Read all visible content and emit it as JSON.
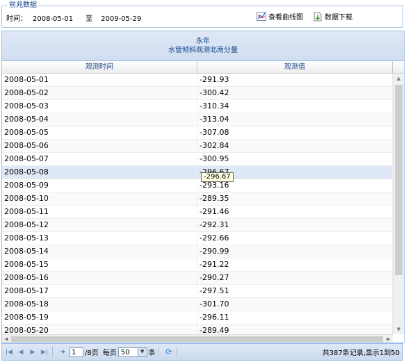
{
  "filter": {
    "legend": "前兆数据",
    "time_label": "时间：",
    "start_date": "2008-05-01",
    "to_label": "至",
    "end_date": "2009-05-29",
    "view_chart_label": "查看曲线图",
    "download_label": "数据下载"
  },
  "grid": {
    "title_line1": "永年",
    "title_line2": "水管倾斜观测北南分量",
    "col_time": "观测时间",
    "col_value": "观测值",
    "rows": [
      {
        "time": "2008-05-01",
        "value": "-291.93"
      },
      {
        "time": "2008-05-02",
        "value": "-300.42"
      },
      {
        "time": "2008-05-03",
        "value": "-310.34"
      },
      {
        "time": "2008-05-04",
        "value": "-313.04"
      },
      {
        "time": "2008-05-05",
        "value": "-307.08"
      },
      {
        "time": "2008-05-06",
        "value": "-302.84"
      },
      {
        "time": "2008-05-07",
        "value": "-300.95"
      },
      {
        "time": "2008-05-08",
        "value": "-296.67"
      },
      {
        "time": "2008-05-09",
        "value": "-293.16"
      },
      {
        "time": "2008-05-10",
        "value": "-289.35"
      },
      {
        "time": "2008-05-11",
        "value": "-291.46"
      },
      {
        "time": "2008-05-12",
        "value": "-292.31"
      },
      {
        "time": "2008-05-13",
        "value": "-292.66"
      },
      {
        "time": "2008-05-14",
        "value": "-290.99"
      },
      {
        "time": "2008-05-15",
        "value": "-291.22"
      },
      {
        "time": "2008-05-16",
        "value": "-290.27"
      },
      {
        "time": "2008-05-17",
        "value": "-297.51"
      },
      {
        "time": "2008-05-18",
        "value": "-301.70"
      },
      {
        "time": "2008-05-19",
        "value": "-296.11"
      },
      {
        "time": "2008-05-20",
        "value": "-289.49"
      }
    ],
    "tooltip": "-296.67"
  },
  "pager": {
    "current_page": "1",
    "page_total": "/8页",
    "per_page_label": "每页",
    "page_size": "50",
    "unit_label": "条",
    "summary": "共387条记录,显示1到50"
  },
  "colors": {
    "accent": "#15428b",
    "border": "#99bbe8",
    "highlight_row": "#dfe8f6"
  }
}
